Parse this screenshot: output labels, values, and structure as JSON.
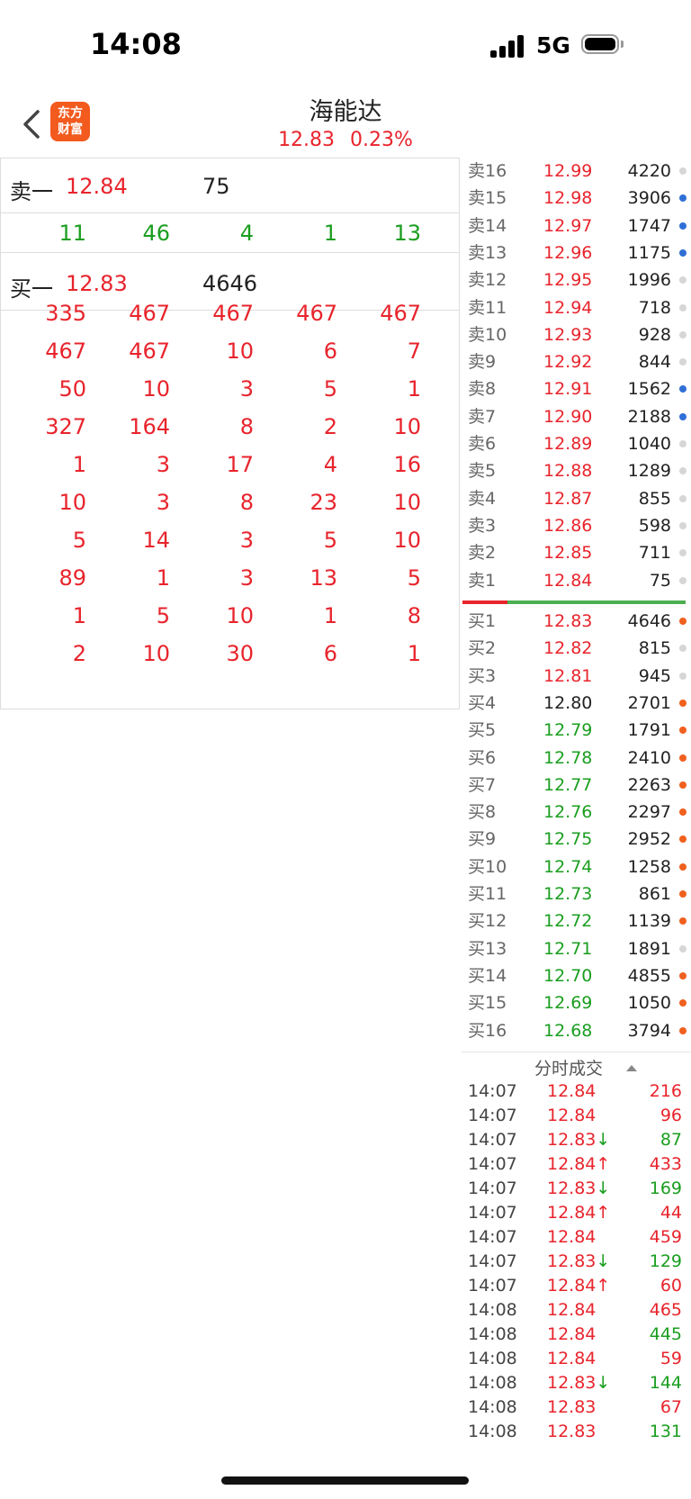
{
  "status_bar": {
    "time": "14:08",
    "network": "5G"
  },
  "header": {
    "title": "海能达",
    "price": "12.83",
    "change_pct": "0.23%",
    "logo_line1": "东方",
    "logo_line2": "财富"
  },
  "left_panel": {
    "ask": {
      "label": "卖一",
      "price": "12.84",
      "volume": "75"
    },
    "ask_queue": [
      "11",
      "46",
      "4",
      "1",
      "13"
    ],
    "bid": {
      "label": "买一",
      "price": "12.83",
      "volume": "4646"
    },
    "bid_queue": [
      [
        "335",
        "467",
        "467",
        "467",
        "467"
      ],
      [
        "467",
        "467",
        "10",
        "6",
        "7"
      ],
      [
        "50",
        "10",
        "3",
        "5",
        "1"
      ],
      [
        "327",
        "164",
        "8",
        "2",
        "10"
      ],
      [
        "1",
        "3",
        "17",
        "4",
        "16"
      ],
      [
        "10",
        "3",
        "8",
        "23",
        "10"
      ],
      [
        "5",
        "14",
        "3",
        "5",
        "10"
      ],
      [
        "89",
        "1",
        "3",
        "13",
        "5"
      ],
      [
        "1",
        "5",
        "10",
        "1",
        "8"
      ],
      [
        "2",
        "10",
        "30",
        "6",
        "1"
      ]
    ]
  },
  "order_book": {
    "asks": [
      {
        "label": "卖16",
        "price": "12.99",
        "volume": "4220",
        "dot": "gray"
      },
      {
        "label": "卖15",
        "price": "12.98",
        "volume": "3906",
        "dot": "blue"
      },
      {
        "label": "卖14",
        "price": "12.97",
        "volume": "1747",
        "dot": "blue"
      },
      {
        "label": "卖13",
        "price": "12.96",
        "volume": "1175",
        "dot": "blue"
      },
      {
        "label": "卖12",
        "price": "12.95",
        "volume": "1996",
        "dot": "gray"
      },
      {
        "label": "卖11",
        "price": "12.94",
        "volume": "718",
        "dot": "gray"
      },
      {
        "label": "卖10",
        "price": "12.93",
        "volume": "928",
        "dot": "gray"
      },
      {
        "label": "卖9",
        "price": "12.92",
        "volume": "844",
        "dot": "gray"
      },
      {
        "label": "卖8",
        "price": "12.91",
        "volume": "1562",
        "dot": "blue"
      },
      {
        "label": "卖7",
        "price": "12.90",
        "volume": "2188",
        "dot": "blue"
      },
      {
        "label": "卖6",
        "price": "12.89",
        "volume": "1040",
        "dot": "gray"
      },
      {
        "label": "卖5",
        "price": "12.88",
        "volume": "1289",
        "dot": "gray"
      },
      {
        "label": "卖4",
        "price": "12.87",
        "volume": "855",
        "dot": "gray"
      },
      {
        "label": "卖3",
        "price": "12.86",
        "volume": "598",
        "dot": "gray"
      },
      {
        "label": "卖2",
        "price": "12.85",
        "volume": "711",
        "dot": "gray"
      },
      {
        "label": "卖1",
        "price": "12.84",
        "volume": "75",
        "dot": "gray"
      }
    ],
    "bids": [
      {
        "label": "买1",
        "price": "12.83",
        "volume": "4646",
        "dot": "orange",
        "color": "red"
      },
      {
        "label": "买2",
        "price": "12.82",
        "volume": "815",
        "dot": "gray",
        "color": "red"
      },
      {
        "label": "买3",
        "price": "12.81",
        "volume": "945",
        "dot": "gray",
        "color": "red"
      },
      {
        "label": "买4",
        "price": "12.80",
        "volume": "2701",
        "dot": "orange",
        "color": "dark"
      },
      {
        "label": "买5",
        "price": "12.79",
        "volume": "1791",
        "dot": "orange",
        "color": "green"
      },
      {
        "label": "买6",
        "price": "12.78",
        "volume": "2410",
        "dot": "orange",
        "color": "green"
      },
      {
        "label": "买7",
        "price": "12.77",
        "volume": "2263",
        "dot": "orange",
        "color": "green"
      },
      {
        "label": "买8",
        "price": "12.76",
        "volume": "2297",
        "dot": "orange",
        "color": "green"
      },
      {
        "label": "买9",
        "price": "12.75",
        "volume": "2952",
        "dot": "orange",
        "color": "green"
      },
      {
        "label": "买10",
        "price": "12.74",
        "volume": "1258",
        "dot": "orange",
        "color": "green"
      },
      {
        "label": "买11",
        "price": "12.73",
        "volume": "861",
        "dot": "orange",
        "color": "green"
      },
      {
        "label": "买12",
        "price": "12.72",
        "volume": "1139",
        "dot": "orange",
        "color": "green"
      },
      {
        "label": "买13",
        "price": "12.71",
        "volume": "1891",
        "dot": "gray",
        "color": "green"
      },
      {
        "label": "买14",
        "price": "12.70",
        "volume": "4855",
        "dot": "orange",
        "color": "green"
      },
      {
        "label": "买15",
        "price": "12.69",
        "volume": "1050",
        "dot": "orange",
        "color": "green"
      },
      {
        "label": "买16",
        "price": "12.68",
        "volume": "3794",
        "dot": "orange",
        "color": "green"
      }
    ]
  },
  "trades": {
    "title": "分时成交",
    "rows": [
      {
        "time": "14:07",
        "price": "12.84",
        "arrow": "",
        "volume": "216",
        "vcolor": "red"
      },
      {
        "time": "14:07",
        "price": "12.84",
        "arrow": "",
        "volume": "96",
        "vcolor": "red"
      },
      {
        "time": "14:07",
        "price": "12.83",
        "arrow": "down",
        "volume": "87",
        "vcolor": "green"
      },
      {
        "time": "14:07",
        "price": "12.84",
        "arrow": "up",
        "volume": "433",
        "vcolor": "red"
      },
      {
        "time": "14:07",
        "price": "12.83",
        "arrow": "down",
        "volume": "169",
        "vcolor": "green"
      },
      {
        "time": "14:07",
        "price": "12.84",
        "arrow": "up",
        "volume": "44",
        "vcolor": "red"
      },
      {
        "time": "14:07",
        "price": "12.84",
        "arrow": "",
        "volume": "459",
        "vcolor": "red"
      },
      {
        "time": "14:07",
        "price": "12.83",
        "arrow": "down",
        "volume": "129",
        "vcolor": "green"
      },
      {
        "time": "14:07",
        "price": "12.84",
        "arrow": "up",
        "volume": "60",
        "vcolor": "red"
      },
      {
        "time": "14:08",
        "price": "12.84",
        "arrow": "",
        "volume": "465",
        "vcolor": "red"
      },
      {
        "time": "14:08",
        "price": "12.84",
        "arrow": "",
        "volume": "445",
        "vcolor": "green"
      },
      {
        "time": "14:08",
        "price": "12.84",
        "arrow": "",
        "volume": "59",
        "vcolor": "red"
      },
      {
        "time": "14:08",
        "price": "12.83",
        "arrow": "down",
        "volume": "144",
        "vcolor": "green"
      },
      {
        "time": "14:08",
        "price": "12.83",
        "arrow": "",
        "volume": "67",
        "vcolor": "red"
      },
      {
        "time": "14:08",
        "price": "12.83",
        "arrow": "",
        "volume": "131",
        "vcolor": "green"
      }
    ]
  },
  "colors": {
    "red": "#e8242c",
    "green": "#1a9e1f",
    "blue_dot": "#2f6fd6",
    "orange_dot": "#f0601f",
    "gray_dot": "#d6d6d6"
  }
}
